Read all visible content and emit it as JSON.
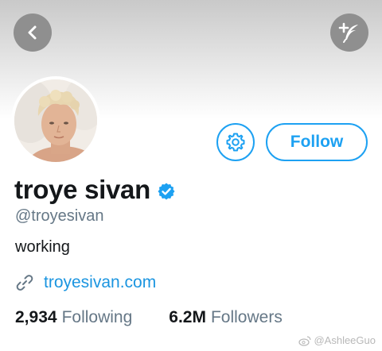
{
  "colors": {
    "accent": "#1da1f2",
    "link": "#1b95e0",
    "secondary_text": "#657786",
    "header_button_bg": "#8f8f8f"
  },
  "header": {
    "back_icon": "chevron-left-icon",
    "compose_icon": "plus-feather-icon"
  },
  "profile": {
    "avatar_icon": "avatar",
    "settings_icon": "gear-icon",
    "follow_label": "Follow",
    "display_name": "troye sivan",
    "verified_icon": "verified-badge-icon",
    "handle": "@troyesivan",
    "bio": "working",
    "link_icon": "link-icon",
    "website": "troyesivan.com",
    "stats": {
      "following_count": "2,934",
      "following_label": "Following",
      "followers_count": "6.2M",
      "followers_label": "Followers"
    }
  },
  "watermark": {
    "icon": "weibo-icon",
    "text": "@AshleeGuo"
  }
}
